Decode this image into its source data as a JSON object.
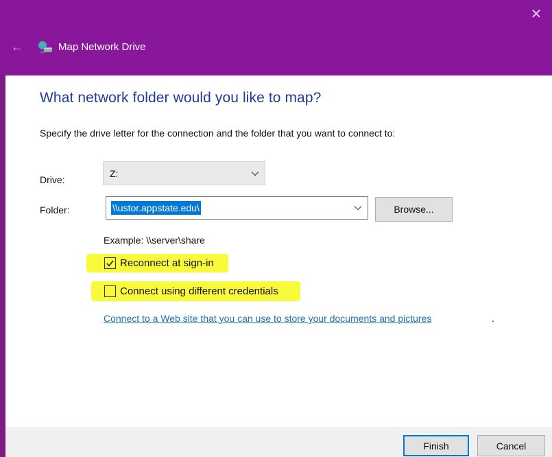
{
  "window": {
    "title": "Map Network Drive",
    "close_glyph": "✕",
    "back_glyph": "←",
    "accent_color": "#89179b"
  },
  "main": {
    "heading": "What network folder would you like to map?",
    "description": "Specify the drive letter for the connection and the folder that you want to connect to:",
    "drive_label": "Drive:",
    "drive_value": "Z:",
    "folder_label": "Folder:",
    "folder_value": "\\\\ustor.appstate.edu\\",
    "browse_label": "Browse...",
    "example_text": "Example: \\\\server\\share",
    "reconnect_label": "Reconnect at sign-in",
    "reconnect_checked": true,
    "credentials_label": "Connect using different credentials",
    "credentials_checked": false,
    "web_link": "Connect to a Web site that you can use to store your documents and pictures",
    "web_link_suffix": "."
  },
  "footer": {
    "finish_label": "Finish",
    "cancel_label": "Cancel"
  },
  "icons": {
    "app": "network-drive-icon",
    "back": "back-arrow-icon",
    "close": "close-icon",
    "dropdown": "chevron-down-icon",
    "check": "checkmark-icon"
  }
}
